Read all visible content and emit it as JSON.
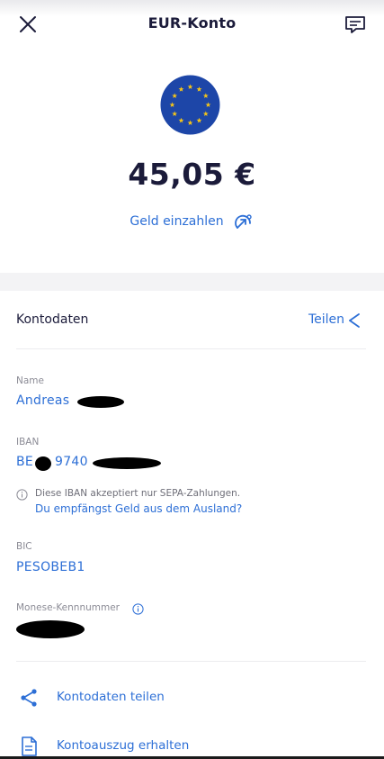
{
  "header": {
    "title": "EUR-Konto",
    "close_icon": "close-icon",
    "chat_icon": "chat-icon"
  },
  "account": {
    "flag_icon": "eu-flag-icon",
    "balance": "45,05 €",
    "deposit_label": "Geld einzahlen",
    "deposit_icon": "deposit-arrow-icon"
  },
  "details": {
    "title": "Kontodaten",
    "share_label": "Teilen",
    "share_icon": "share-icon",
    "name_label": "Name",
    "name_value": "Andreas",
    "iban_label": "IBAN",
    "iban_prefix": "BE",
    "iban_visible": "9740",
    "iban_note": "Diese IBAN akzeptiert nur SEPA-Zahlungen.",
    "iban_link": "Du empfängst Geld aus dem Ausland?",
    "bic_label": "BIC",
    "bic_value": "PESOBEB1",
    "monese_label": "Monese-Kennnummer"
  },
  "actions": [
    {
      "label": "Kontodaten teilen",
      "icon": "share-icon"
    },
    {
      "label": "Kontoauszug erhalten",
      "icon": "document-icon"
    }
  ],
  "colors": {
    "accent": "#2d6fd6",
    "text": "#1b1b3a",
    "eu_blue": "#1d46a8",
    "eu_star": "#f5c518"
  }
}
